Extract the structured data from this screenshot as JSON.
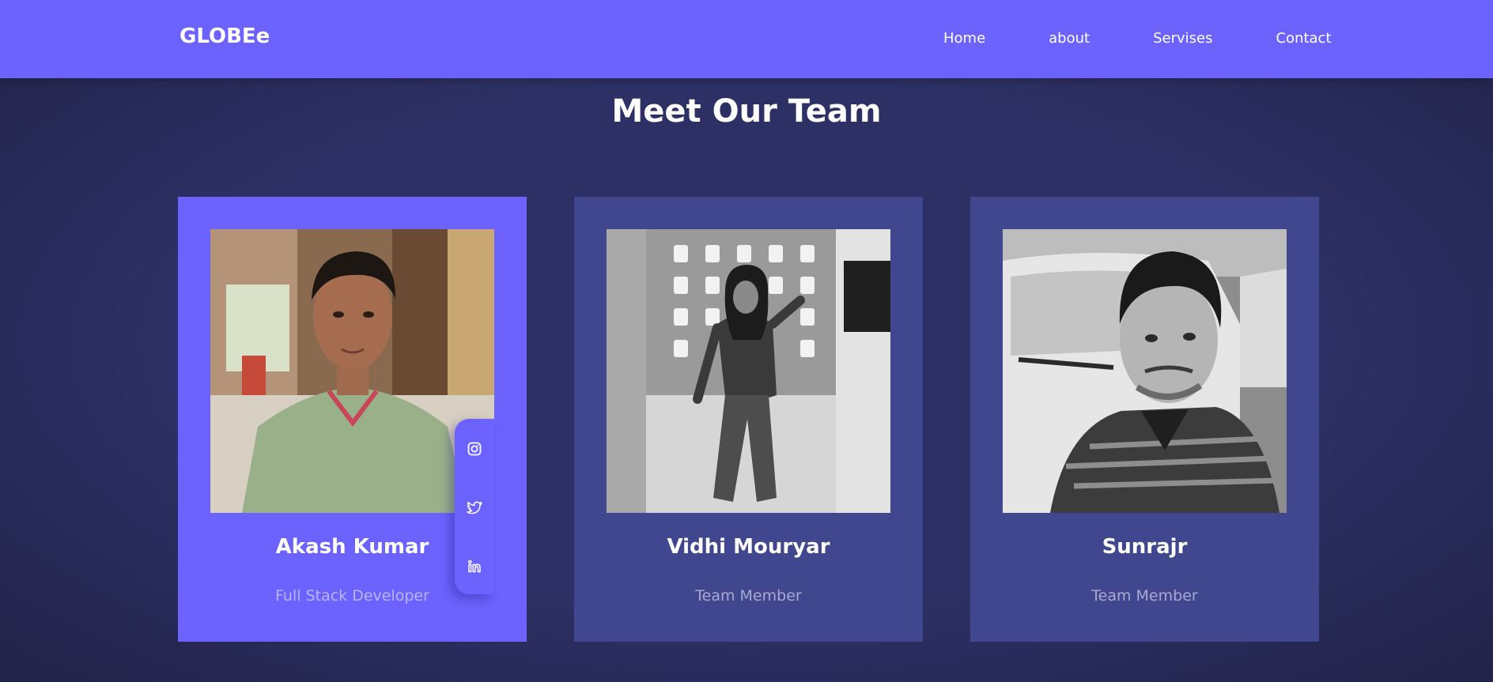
{
  "navbar": {
    "brand": "GLOBEe",
    "links": [
      "Home",
      "about",
      "Servises",
      "Contact"
    ]
  },
  "section": {
    "title": "Meet Our Team"
  },
  "team": [
    {
      "name": "Akash Kumar",
      "role": "Full Stack Developer"
    },
    {
      "name": "Vidhi Mouryar",
      "role": "Team Member"
    },
    {
      "name": "Sunrajr",
      "role": "Team Member"
    }
  ],
  "social_icons": [
    "instagram-icon",
    "twitter-icon",
    "linkedin-icon"
  ],
  "colors": {
    "primary": "#6c63ff",
    "background": "#2d3064",
    "card": "#41478e",
    "muted_text": "#a8a9cf"
  }
}
